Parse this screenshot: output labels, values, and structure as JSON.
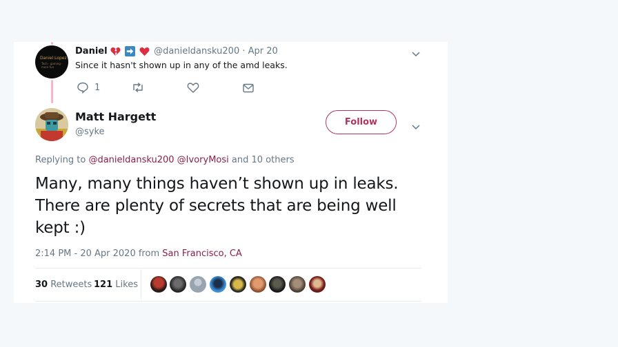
{
  "reply": {
    "name": "Daniel",
    "handle": "@danieldansku200",
    "separator": "·",
    "date": "Apr 20",
    "text": "Since it hasn't shown up in any of the amd leaks.",
    "reply_count": "1",
    "avatar_text": "Daniel Lopez",
    "avatar_subtext": "Tech · gaming · more fun"
  },
  "main": {
    "name": "Matt Hargett",
    "handle": "@syke",
    "follow_label": "Follow",
    "replying_prefix": "Replying to",
    "replying_users": [
      "@danieldansku200",
      "@IvoryMosi"
    ],
    "replying_suffix": "and 10 others",
    "text": "Many, many things haven’t shown up in leaks. There are plenty of secrets that are being well kept :)",
    "time": "2:14 PM - 20 Apr 2020",
    "from_label": "from",
    "location": "San Francisco, CA",
    "retweets_count": "30",
    "retweets_label": "Retweets",
    "likes_count": "121",
    "likes_label": "Likes"
  },
  "colors": {
    "accent": "#8a1e4a",
    "follow": "#b0345f",
    "thread_line": "#f6b6c9",
    "muted": "#657786"
  }
}
